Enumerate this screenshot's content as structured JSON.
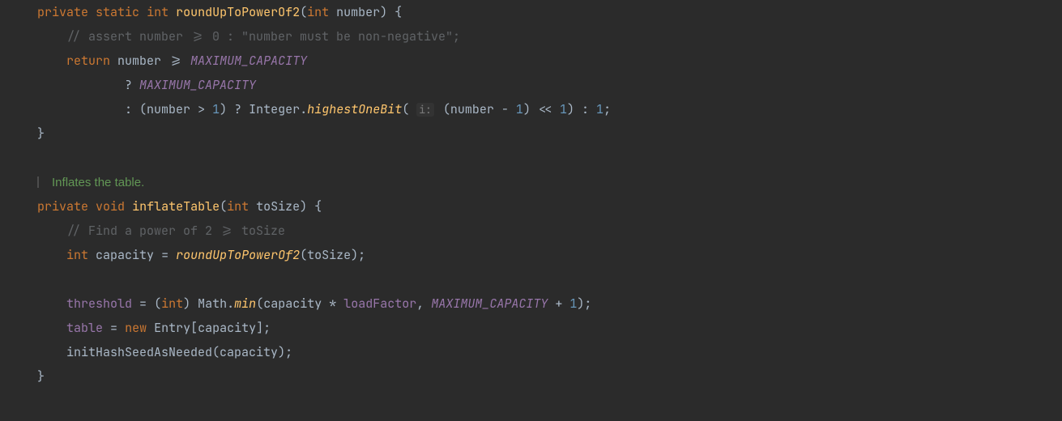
{
  "code": {
    "l1": {
      "kw_private": "private",
      "kw_static": "static",
      "kw_int": "int",
      "fn": "roundUpToPowerOf2",
      "param_type": "int",
      "param_name": "number",
      "brace": ") {"
    },
    "l2": {
      "comment": "// assert number >= 0 : \"number must be non-negative\";"
    },
    "l3": {
      "kw_return": "return",
      "ident": "number",
      "op": ">=",
      "const": "MAXIMUM_CAPACITY"
    },
    "l4": {
      "q": "?",
      "const": "MAXIMUM_CAPACITY"
    },
    "l5": {
      "colon": ":",
      "ident": "number",
      "gt": ">",
      "one": "1",
      "q": "?",
      "cls": "Integer",
      "dot": ".",
      "method": "highestOneBit",
      "hint": "i:",
      "ident2": "number",
      "minus": "-",
      "one2": "1",
      "shift": "<<",
      "one3": "1",
      "colon2": ":",
      "one4": "1",
      "semi": ";"
    },
    "l6": {
      "brace": "}"
    },
    "doc": {
      "text": "Inflates the table."
    },
    "l8": {
      "kw_private": "private",
      "kw_void": "void",
      "fn": "inflateTable",
      "param_type": "int",
      "param_name": "toSize",
      "brace": ") {"
    },
    "l9": {
      "comment": "// Find a power of 2 >= toSize"
    },
    "l10": {
      "kw_int": "int",
      "ident": "capacity",
      "eq": "=",
      "fn": "roundUpToPowerOf2",
      "arg": "toSize",
      "semi": ");"
    },
    "l12": {
      "fld": "threshold",
      "eq": "=",
      "cast_open": "(",
      "cast_kw": "int",
      "cast_close": ")",
      "cls": "Math",
      "dot": ".",
      "method": "min",
      "arg1": "capacity",
      "mul": "*",
      "fld2": "loadFactor",
      "comma": ",",
      "const": "MAXIMUM_CAPACITY",
      "plus": "+",
      "one": "1",
      "semi": ");"
    },
    "l13": {
      "fld": "table",
      "eq": "=",
      "kw_new": "new",
      "cls": "Entry",
      "open": "[",
      "arg": "capacity",
      "close": "];"
    },
    "l14": {
      "fn": "initHashSeedAsNeeded",
      "arg": "capacity",
      "semi": ");"
    },
    "l15": {
      "brace": "}"
    }
  }
}
